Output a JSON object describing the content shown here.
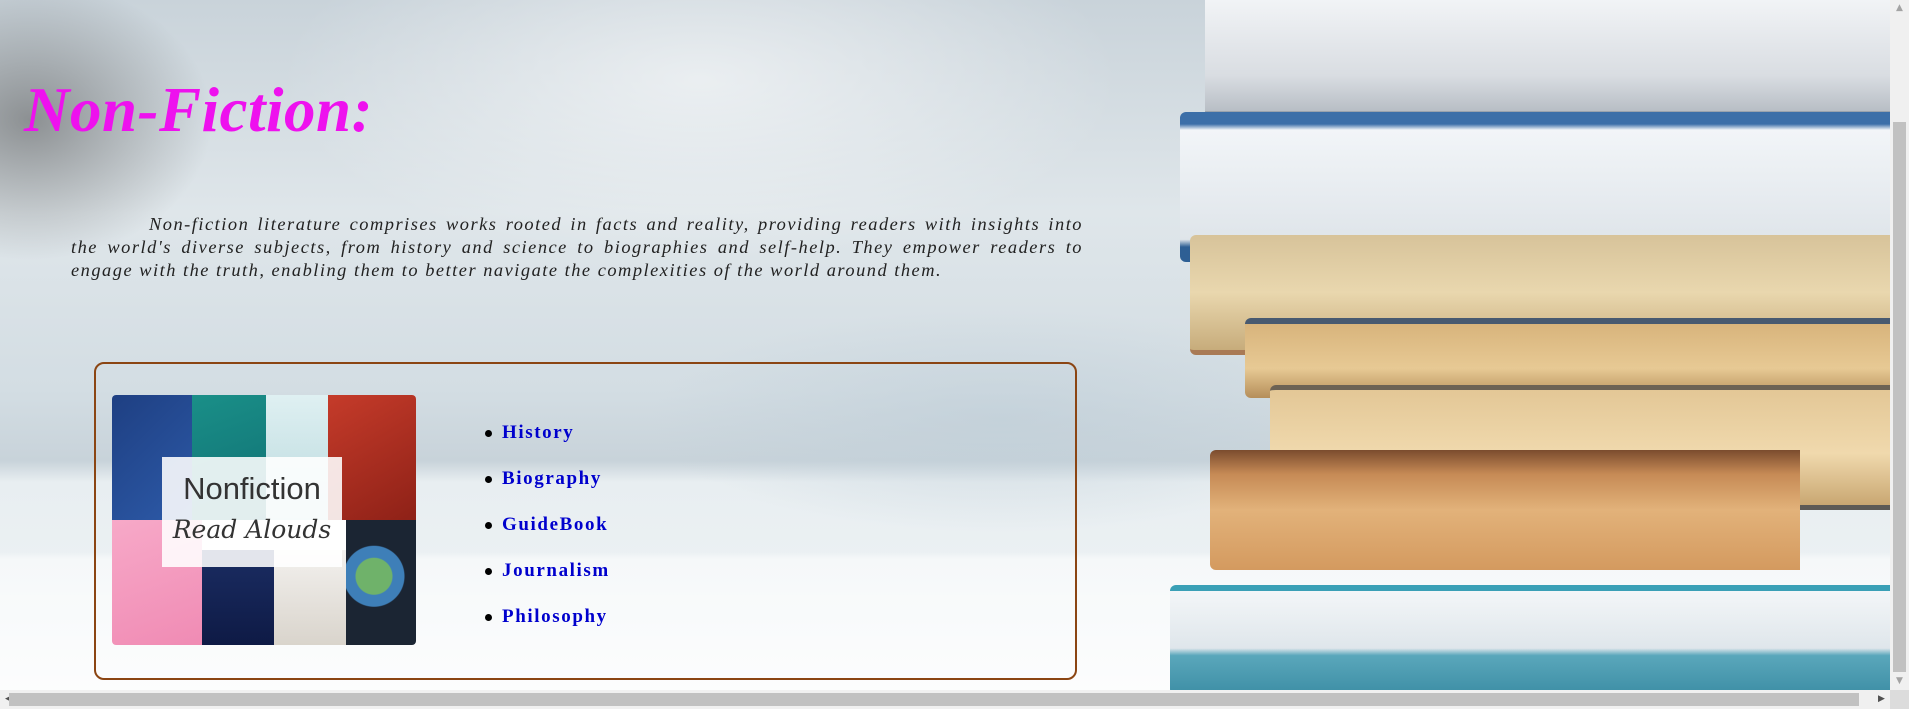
{
  "page": {
    "title": "Non-Fiction:",
    "intro": "Non-fiction literature comprises works rooted in facts and reality, providing readers with insights into the world's diverse subjects, from history and science to biographies and self-help. They empower readers to engage with the truth, enabling them to better navigate the complexities of the world around them."
  },
  "card": {
    "image": {
      "icon": "nonfiction-read-alouds-collage",
      "line1": "Nonfiction",
      "line2": "Read Alouds"
    },
    "topics": [
      {
        "label": "History"
      },
      {
        "label": "Biography"
      },
      {
        "label": "GuideBook"
      },
      {
        "label": "Journalism"
      },
      {
        "label": "Philosophy"
      }
    ]
  },
  "colors": {
    "title": "#ee11ee",
    "link": "#0000cd",
    "card_border": "#8b4513"
  }
}
